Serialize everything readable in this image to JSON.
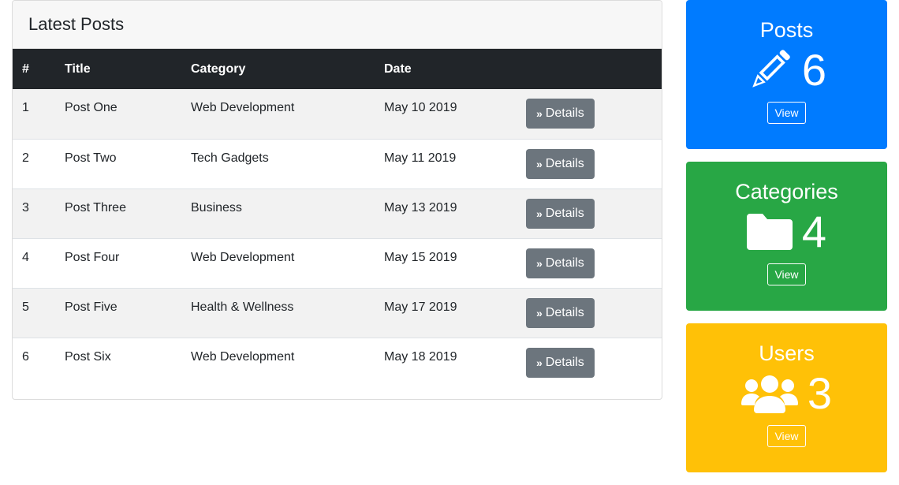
{
  "latest_posts": {
    "title": "Latest Posts",
    "columns": [
      "#",
      "Title",
      "Category",
      "Date"
    ],
    "details_label": "Details",
    "rows": [
      {
        "num": "1",
        "title": "Post One",
        "category": "Web Development",
        "date": "May 10 2019"
      },
      {
        "num": "2",
        "title": "Post Two",
        "category": "Tech Gadgets",
        "date": "May 11 2019"
      },
      {
        "num": "3",
        "title": "Post Three",
        "category": "Business",
        "date": "May 13 2019"
      },
      {
        "num": "4",
        "title": "Post Four",
        "category": "Web Development",
        "date": "May 15 2019"
      },
      {
        "num": "5",
        "title": "Post Five",
        "category": "Health & Wellness",
        "date": "May 17 2019"
      },
      {
        "num": "6",
        "title": "Post Six",
        "category": "Web Development",
        "date": "May 18 2019"
      }
    ]
  },
  "stats": [
    {
      "title": "Posts",
      "count": "6",
      "icon": "pencil-icon",
      "button": "View",
      "color": "#007bff"
    },
    {
      "title": "Categories",
      "count": "4",
      "icon": "folder-icon",
      "button": "View",
      "color": "#28a745"
    },
    {
      "title": "Users",
      "count": "3",
      "icon": "users-icon",
      "button": "View",
      "color": "#ffc107"
    }
  ],
  "colors": {
    "table_header": "#212529",
    "details_button": "#6c757d"
  }
}
